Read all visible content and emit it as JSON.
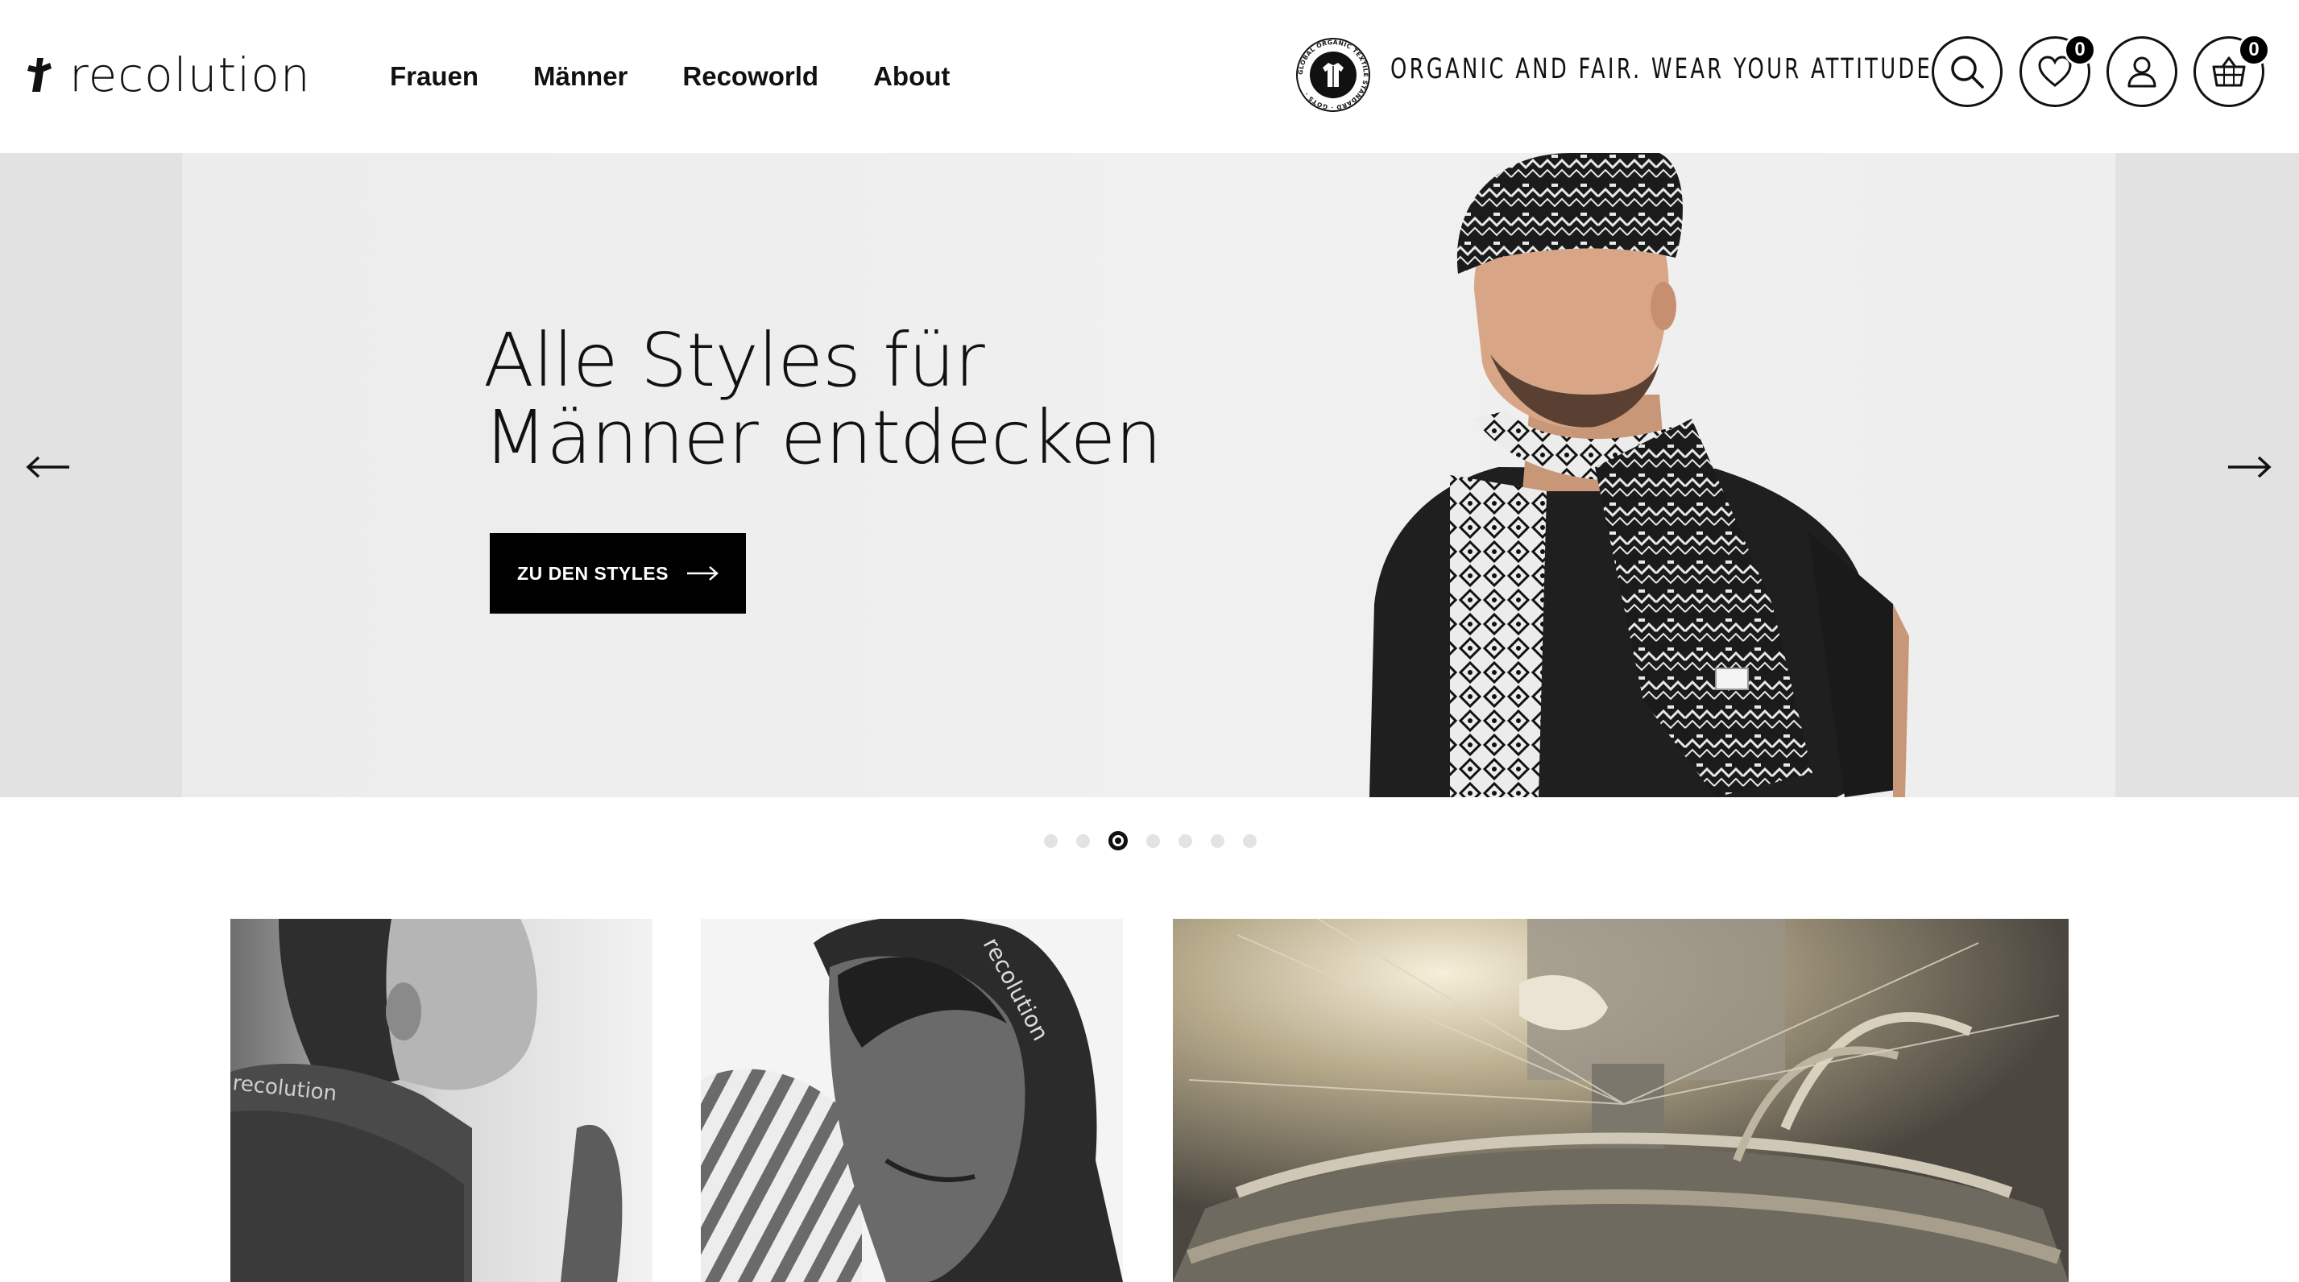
{
  "brand": {
    "name": "recolution"
  },
  "nav": {
    "items": [
      "Frauen",
      "Männer",
      "Recoworld",
      "About"
    ]
  },
  "header": {
    "tagline": "ORGANIC AND FAIR. WEAR YOUR ATTITUDE.",
    "gots_seal_text": "GLOBAL ORGANIC TEXTILE STANDARD · GOTS ·",
    "wishlist_count": "0",
    "cart_count": "0",
    "icons": [
      "search-icon",
      "heart-icon",
      "user-icon",
      "basket-icon"
    ]
  },
  "hero": {
    "title_line1": "Alle Styles für",
    "title_line2": "Männer entdecken",
    "cta_label": "ZU DEN STYLES",
    "active_slide": 3,
    "slide_count": 7
  },
  "tiles": [
    {
      "brand_print": "recolution"
    },
    {
      "brand_print": "recolution"
    },
    {}
  ],
  "colors": {
    "accent": "#000000",
    "background": "#ffffff",
    "hero_bg": "#ececec",
    "dot_inactive": "#e3e3e3"
  }
}
